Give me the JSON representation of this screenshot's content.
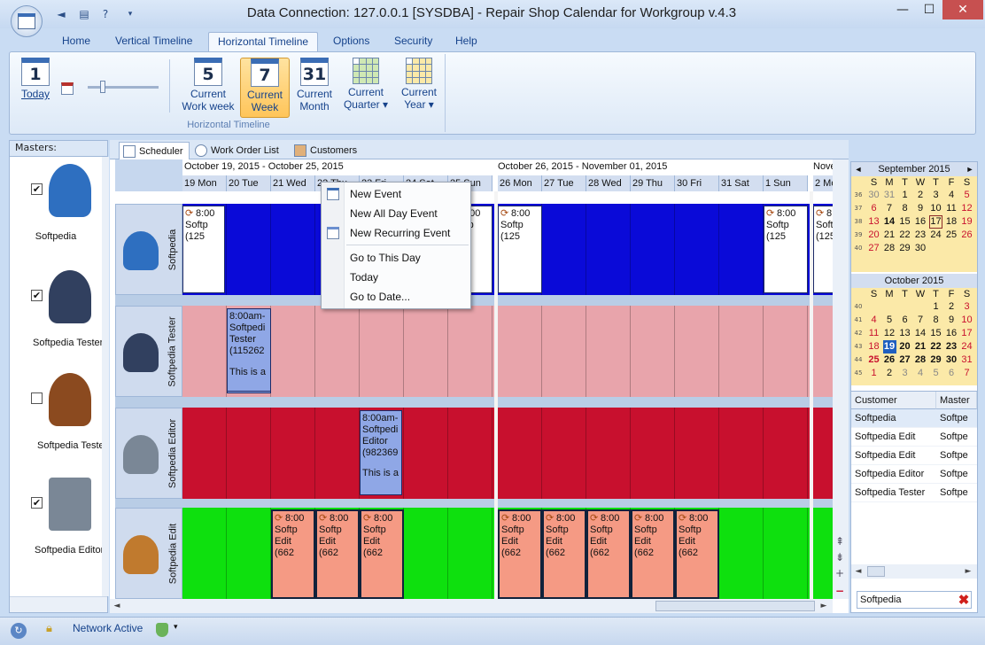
{
  "window": {
    "title": "Data Connection: 127.0.0.1 [SYSDBA] - Repair Shop Calendar for Workgroup v.4.3",
    "min_label": "—",
    "max_label": "☐",
    "close_label": "✕"
  },
  "ribbon": {
    "tabs": [
      "Home",
      "Vertical Timeline",
      "Horizontal Timeline",
      "Options",
      "Security",
      "Help"
    ],
    "group_label": "Horizontal Timeline",
    "today": {
      "icon_num": "1",
      "label": "Today"
    },
    "work_week": {
      "icon_num": "5",
      "line1": "Current",
      "line2": "Work week"
    },
    "week": {
      "icon_num": "7",
      "line1": "Current",
      "line2": "Week"
    },
    "month": {
      "icon_num": "31",
      "line1": "Current",
      "line2": "Month"
    },
    "quarter": {
      "line1": "Current",
      "line2": "Quarter ▾"
    },
    "year": {
      "line1": "Current",
      "line2": "Year ▾"
    }
  },
  "masters": {
    "header": "Masters:",
    "items": [
      {
        "name": "Softpedia",
        "checked": "✔",
        "color": "#2e6fc0"
      },
      {
        "name": "Softpedia Tester",
        "checked": "✔",
        "color": "#31405f"
      },
      {
        "name": "Softpedia Tester",
        "checked": "",
        "color": "#8b4a1f"
      },
      {
        "name": "Softpedia Editor",
        "checked": "✔",
        "color": "#7a8796"
      }
    ]
  },
  "subtabs": [
    "Scheduler",
    "Work Order List",
    "Customers"
  ],
  "scheduler": {
    "week1_label": "October 19, 2015 - October 25, 2015",
    "week2_label": "October 26, 2015 - November 01, 2015",
    "week3_label": "Nove",
    "days": [
      "19 Mon",
      "20 Tue",
      "21 Wed",
      "22 Thu",
      "23 Fri",
      "24 Sat",
      "25 Sun",
      "26 Mon",
      "27 Tue",
      "28 Wed",
      "29 Thu",
      "30 Fri",
      "31 Sat",
      "1 Sun",
      "2 Mo"
    ],
    "rows": [
      {
        "name": "Softpedia",
        "bg": "#0a0ad8"
      },
      {
        "name": "Softpedia Tester",
        "bg": "#e8a4ab"
      },
      {
        "name": "Softpedia Editor",
        "bg": "#c8102e"
      },
      {
        "name": "Softpedia Edit",
        "bg": "#0ee00e"
      }
    ],
    "ev_row1": {
      "time": "8:00",
      "l1": "Softp",
      "l2": "(125"
    },
    "ev_tester": {
      "time": "8:00am-",
      "l1": "Softpedi",
      "l2": "Tester",
      "l3": "(115262",
      "note": "This is a"
    },
    "ev_editor": {
      "time": "8:00am-",
      "l1": "Softpedi",
      "l2": "Editor",
      "l3": "(982369",
      "note": "This is a"
    },
    "ev_row4": {
      "time": "8:00",
      "l1": "Softp",
      "l2": "Edit",
      "l3": "(662"
    }
  },
  "context_menu": {
    "items": [
      "New Event",
      "New All Day Event",
      "New Recurring Event",
      "Go to This Day",
      "Today",
      "Go to Date..."
    ]
  },
  "calendar": {
    "sep_title": "September 2015",
    "oct_title": "October 2015",
    "dow": [
      "S",
      "M",
      "T",
      "W",
      "T",
      "F",
      "S"
    ],
    "sep_weeks": [
      "36",
      "37",
      "38",
      "39",
      "40"
    ],
    "oct_weeks": [
      "40",
      "41",
      "42",
      "43",
      "44",
      "45"
    ],
    "sep_days": [
      [
        "30",
        "31",
        "1",
        "2",
        "3",
        "4",
        "5"
      ],
      [
        "6",
        "7",
        "8",
        "9",
        "10",
        "11",
        "12"
      ],
      [
        "13",
        "14",
        "15",
        "16",
        "17",
        "18",
        "19"
      ],
      [
        "20",
        "21",
        "22",
        "23",
        "24",
        "25",
        "26"
      ],
      [
        "27",
        "28",
        "29",
        "30",
        "",
        "",
        ""
      ]
    ],
    "oct_days": [
      [
        "",
        "",
        "",
        "",
        "1",
        "2",
        "3"
      ],
      [
        "4",
        "5",
        "6",
        "7",
        "8",
        "9",
        "10"
      ],
      [
        "11",
        "12",
        "13",
        "14",
        "15",
        "16",
        "17"
      ],
      [
        "18",
        "19",
        "20",
        "21",
        "22",
        "23",
        "24"
      ],
      [
        "25",
        "26",
        "27",
        "28",
        "29",
        "30",
        "31"
      ],
      [
        "1",
        "2",
        "3",
        "4",
        "5",
        "6",
        "7"
      ]
    ]
  },
  "customers": {
    "col1": "Customer",
    "col2": "Master",
    "rows": [
      [
        "Softpedia",
        "Softpe"
      ],
      [
        "Softpedia Edit",
        "Softpe"
      ],
      [
        "Softpedia Edit",
        "Softpe"
      ],
      [
        "Softpedia Editor",
        "Softpe"
      ],
      [
        "Softpedia Tester",
        "Softpe"
      ]
    ],
    "search_value": "Softpedia",
    "clear_label": "✖"
  },
  "status": {
    "network": "Network Active"
  }
}
